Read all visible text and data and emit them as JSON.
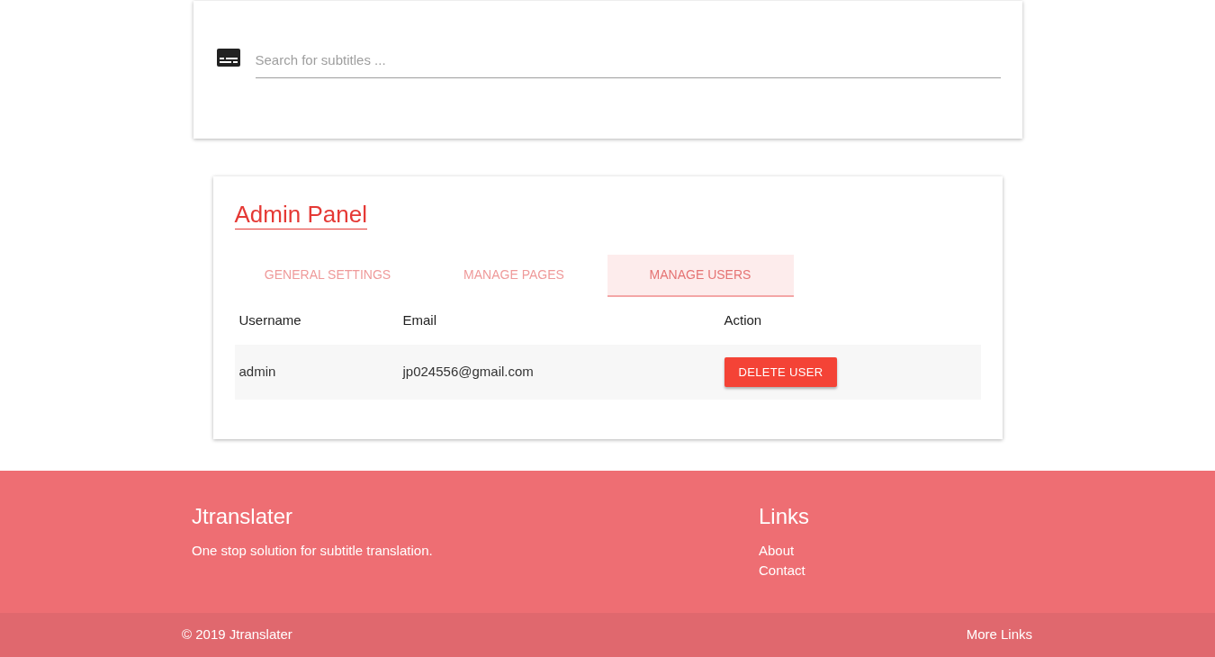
{
  "search": {
    "placeholder": "Search for subtitles ..."
  },
  "admin_panel": {
    "title": "Admin Panel",
    "tabs": [
      {
        "label": "GENERAL SETTINGS",
        "selected": false
      },
      {
        "label": "MANAGE PAGES",
        "selected": false
      },
      {
        "label": "MANAGE USERS",
        "selected": true
      }
    ],
    "table": {
      "columns": [
        "Username",
        "Email",
        "Action"
      ],
      "rows": [
        {
          "username": "admin",
          "email": "jp024556@gmail.com",
          "action": "DELETE USER"
        }
      ]
    }
  },
  "footer": {
    "brand": "Jtranslater",
    "tagline": "One stop solution for subtitle translation.",
    "links_title": "Links",
    "links": [
      "About",
      "Contact"
    ],
    "copyright": "© 2019 Jtranslater",
    "more_links": "More Links"
  }
}
